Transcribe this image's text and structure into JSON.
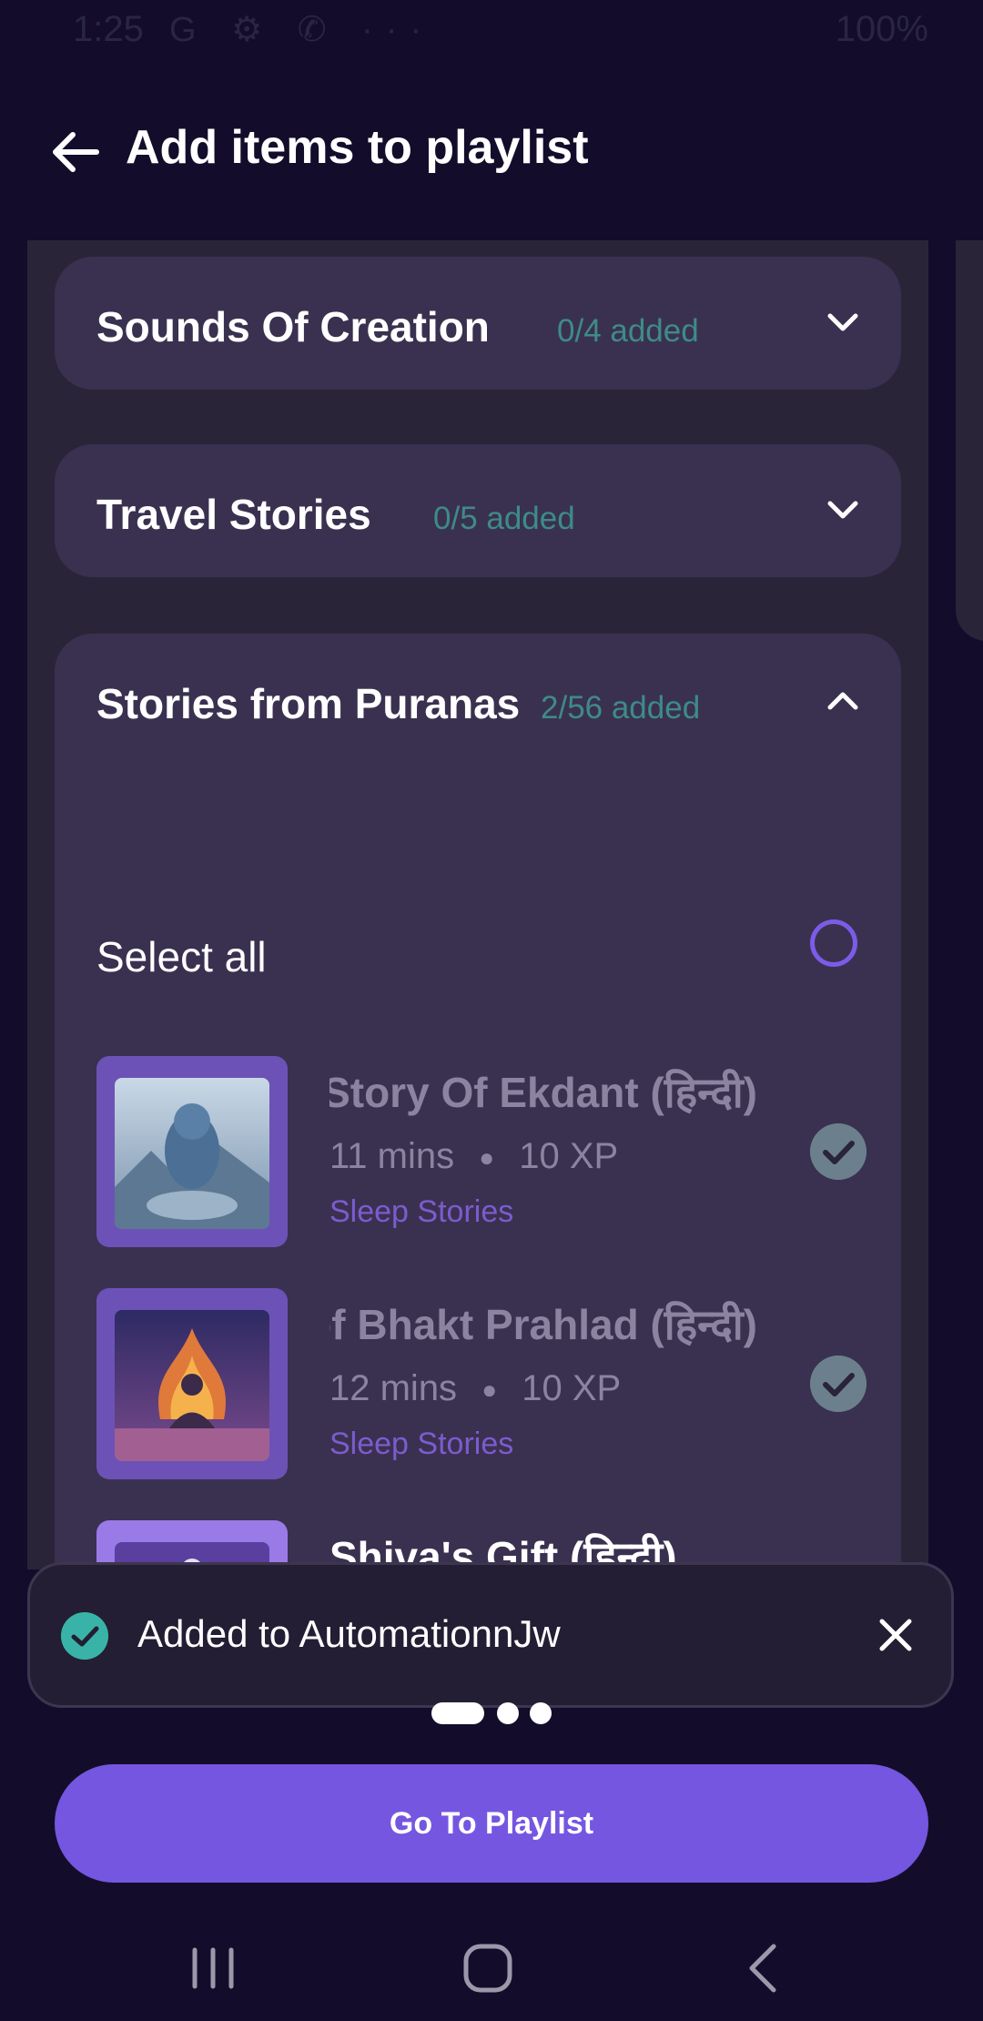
{
  "status_bar": {
    "time": "1:25",
    "left_icons": "G ⚙ ✆ ···",
    "battery": "100%"
  },
  "header": {
    "title": "Add items to playlist"
  },
  "categories": [
    {
      "title": "Sounds Of Creation",
      "count": "0/4 added",
      "state": "collapsed"
    },
    {
      "title": "Travel Stories",
      "count": "0/5 added",
      "state": "collapsed"
    },
    {
      "title": "Stories from Puranas",
      "count": "2/56 added",
      "state": "expanded"
    }
  ],
  "expanded": {
    "select_all_label": "Select all",
    "items": [
      {
        "title": "Story Of Ekdant (हिन्दी)",
        "duration": "11 mins",
        "xp": "10 XP",
        "category": "Sleep Stories",
        "selected": true
      },
      {
        "title": "Story of Bhakt Prahlad (हिन्दी)",
        "duration": "12 mins",
        "xp": "10 XP",
        "category": "Sleep Stories",
        "selected": true
      },
      {
        "title": "Shiva's Gift (हिन्दी)",
        "duration": "",
        "xp": "",
        "category": "",
        "selected": false
      }
    ]
  },
  "toast": {
    "message": "Added to AutomationnJw"
  },
  "cta": {
    "label": "Go To Playlist"
  },
  "colors": {
    "background": "#130d2b",
    "panel": "#2a2439",
    "card": "#3a3150",
    "accent": "#7556e0",
    "count_teal": "#3e8b88",
    "toast_check": "#39b3a7"
  }
}
